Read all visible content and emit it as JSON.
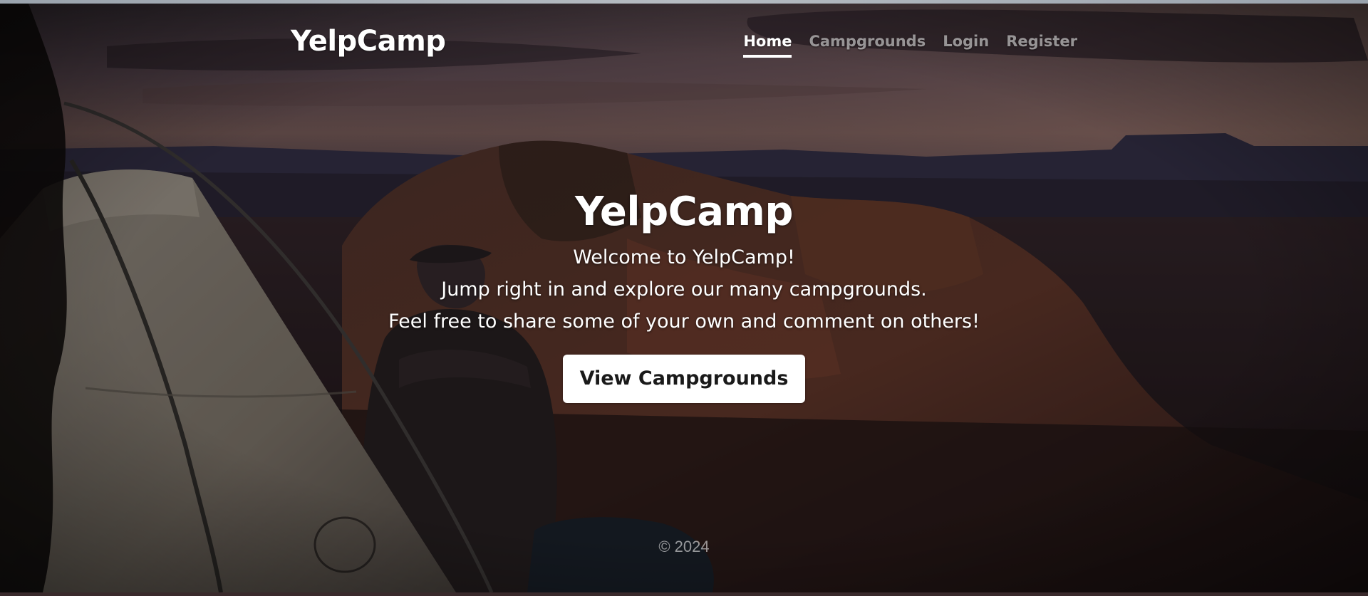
{
  "navbar": {
    "brand": "YelpCamp",
    "links": [
      {
        "label": "Home",
        "active": true
      },
      {
        "label": "Campgrounds",
        "active": false
      },
      {
        "label": "Login",
        "active": false
      },
      {
        "label": "Register",
        "active": false
      }
    ]
  },
  "hero": {
    "title": "YelpCamp",
    "lines": [
      "Welcome to YelpCamp!",
      "Jump right in and explore our many campgrounds.",
      "Feel free to share some of your own and comment on others!"
    ],
    "button_label": "View Campgrounds"
  },
  "footer": {
    "copyright": "© 2024"
  },
  "colors": {
    "nav_active": "#ffffff",
    "nav_inactive": "#ffffff8c",
    "button_bg": "#ffffff",
    "button_text": "#1a1a1a",
    "overlay": "#000000"
  },
  "background": {
    "icon": "camping-landscape-photo"
  }
}
